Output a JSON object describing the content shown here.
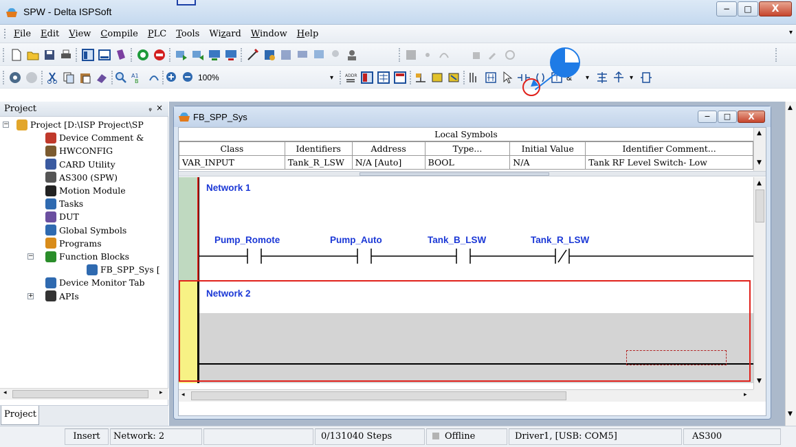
{
  "window": {
    "title": "SPW - Delta ISPSoft",
    "controls": {
      "minimize": "−",
      "maximize": "□",
      "close": "X"
    }
  },
  "menu": [
    "File",
    "Edit",
    "View",
    "Compile",
    "PLC",
    "Tools",
    "Wizard",
    "Window",
    "Help"
  ],
  "menu_underlines": [
    "F",
    "E",
    "V",
    "C",
    "P",
    "T",
    "z",
    "W",
    "H"
  ],
  "toolbar2": {
    "zoom": "100%"
  },
  "project_pane": {
    "title": "Project",
    "pin_glyph": "ᵩ",
    "close_glyph": "×",
    "tab": "Project",
    "tree": [
      {
        "label": "Project [D:\\ISP Project\\SP",
        "icon": "project-folder-icon",
        "depth": 0
      },
      {
        "label": "Device Comment &",
        "icon": "device-comment-icon",
        "depth": 1
      },
      {
        "label": "HWCONFIG",
        "icon": "hwconfig-icon",
        "depth": 1
      },
      {
        "label": "CARD Utility",
        "icon": "card-utility-icon",
        "depth": 1
      },
      {
        "label": "AS300  (SPW)",
        "icon": "as300-icon",
        "depth": 1
      },
      {
        "label": "Motion Module",
        "icon": "motion-module-icon",
        "depth": 1
      },
      {
        "label": "Tasks",
        "icon": "tasks-icon",
        "depth": 1
      },
      {
        "label": "DUT",
        "icon": "dut-icon",
        "depth": 1
      },
      {
        "label": "Global Symbols",
        "icon": "global-symbols-icon",
        "depth": 1
      },
      {
        "label": "Programs",
        "icon": "programs-icon",
        "depth": 1
      },
      {
        "label": "Function Blocks",
        "icon": "function-blocks-icon",
        "depth": 1
      },
      {
        "label": "FB_SPP_Sys [",
        "icon": "fb-icon",
        "depth": 2
      },
      {
        "label": "Device Monitor Tab",
        "icon": "device-monitor-icon",
        "depth": 1
      },
      {
        "label": "APIs",
        "icon": "apis-icon",
        "depth": 1
      }
    ]
  },
  "editor": {
    "title": "FB_SPP_Sys",
    "local_symbols_label": "Local Symbols",
    "columns": [
      "Class",
      "Identifiers",
      "Address",
      "Type...",
      "Initial Value",
      "Identifier Comment..."
    ],
    "rows": [
      [
        "VAR_INPUT",
        "Tank_R_LSW",
        "N/A [Auto]",
        "BOOL",
        "N/A",
        "Tank RF Level Switch- Low"
      ]
    ],
    "networks": [
      {
        "label": "Network 1",
        "contacts": [
          {
            "name": "Pump_Romote",
            "type": "NO"
          },
          {
            "name": "Pump_Auto",
            "type": "NO"
          },
          {
            "name": "Tank_B_LSW",
            "type": "NO"
          },
          {
            "name": "Tank_R_LSW",
            "type": "NC"
          }
        ]
      },
      {
        "label": "Network 2",
        "contacts": []
      }
    ]
  },
  "status_bar": {
    "mode": "Insert",
    "network": "Network: 2",
    "steps": "0/131040 Steps",
    "connection": "Offline",
    "driver": "Driver1, [USB: COM5]",
    "model": "AS300"
  },
  "colors": {
    "network_label": "#1b38d6",
    "highlight_red": "#e0201a",
    "annotation_blue": "#1e7be6",
    "rail_network1": "#bfd9c0",
    "rail_network2": "#f7f285"
  }
}
